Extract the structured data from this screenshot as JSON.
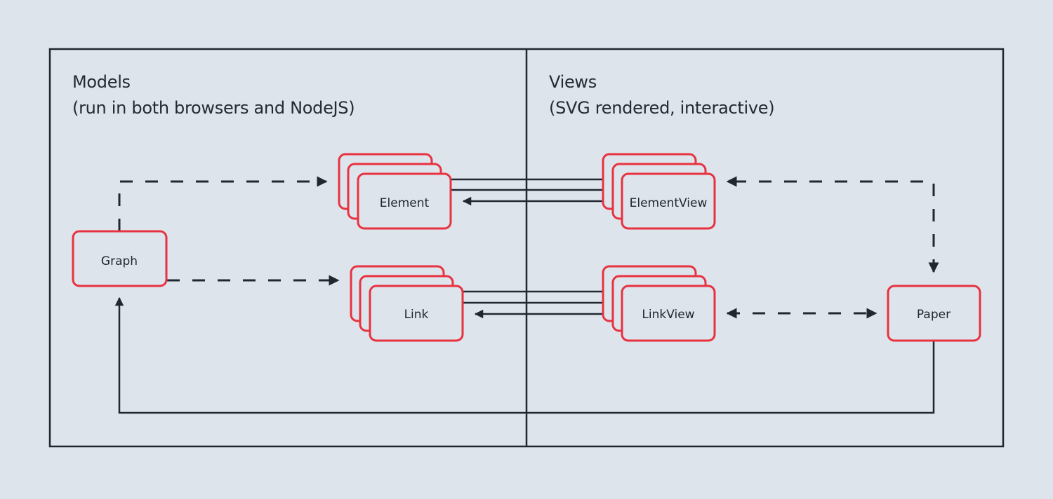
{
  "colors": {
    "background": "#dde4ec",
    "line": "#1f2730",
    "node_border": "#e8323f",
    "node_fill": "#dde4ec",
    "text": "#1e252d"
  },
  "panels": {
    "models": {
      "title": "Models",
      "subtitle": "(run in both browsers and NodeJS)"
    },
    "views": {
      "title": "Views",
      "subtitle": "(SVG rendered, interactive)"
    }
  },
  "nodes": {
    "graph": {
      "label": "Graph",
      "stacked": false
    },
    "element": {
      "label": "Element",
      "stacked": true
    },
    "link": {
      "label": "Link",
      "stacked": true
    },
    "element_view": {
      "label": "ElementView",
      "stacked": true
    },
    "link_view": {
      "label": "LinkView",
      "stacked": true
    },
    "paper": {
      "label": "Paper",
      "stacked": false
    }
  },
  "edges": [
    {
      "from": "graph",
      "to": "element",
      "style": "dashed",
      "arrow": "end"
    },
    {
      "from": "graph",
      "to": "link",
      "style": "dashed",
      "arrow": "end"
    },
    {
      "from": "element_view",
      "to": "element",
      "style": "solid",
      "arrow": "end",
      "count": 3
    },
    {
      "from": "link_view",
      "to": "link",
      "style": "solid",
      "arrow": "end",
      "count": 3
    },
    {
      "from": "paper",
      "to": "element_view",
      "style": "dashed",
      "arrow": "both"
    },
    {
      "from": "paper",
      "to": "link_view",
      "style": "dashed",
      "arrow": "both"
    },
    {
      "from": "paper",
      "to": "graph",
      "style": "solid",
      "arrow": "end"
    }
  ]
}
